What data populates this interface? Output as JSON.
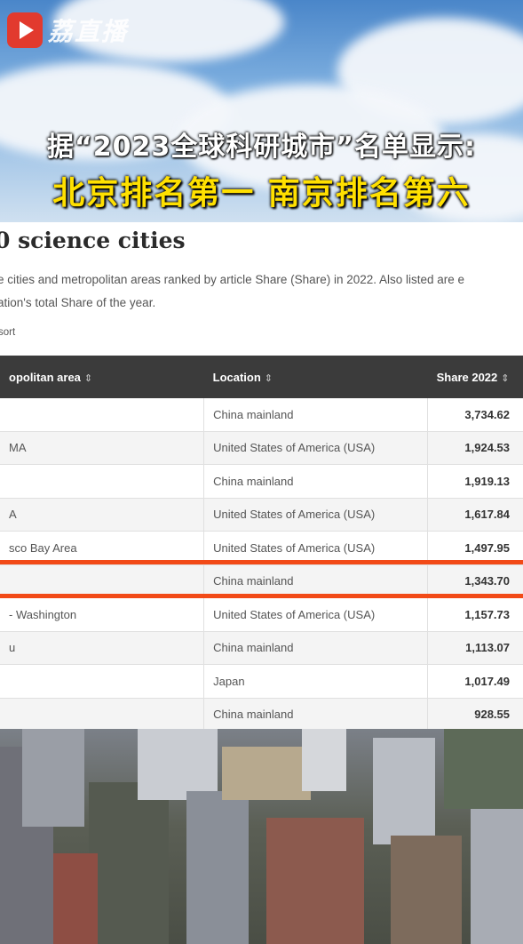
{
  "header": {
    "brand": "荔直播",
    "headline_line1": "据“2023全球科研城市”名单显示:",
    "headline_line2": "北京排名第一 南京排名第六"
  },
  "article": {
    "title": "0 science cities",
    "desc_line1": "e cities and metropolitan areas ranked by article Share (Share) in 2022. Also listed are e",
    "desc_line2": "ation's total Share of the year.",
    "sort_note": "sort"
  },
  "table": {
    "columns": [
      "opolitan area",
      "Location",
      "Share 2022"
    ],
    "sort_icon": "⇕",
    "rows": [
      {
        "area": "",
        "location": "China mainland",
        "share": "3,734.62"
      },
      {
        "area": "MA",
        "location": "United States of America (USA)",
        "share": "1,924.53"
      },
      {
        "area": "",
        "location": "China mainland",
        "share": "1,919.13"
      },
      {
        "area": "A",
        "location": "United States of America (USA)",
        "share": "1,617.84"
      },
      {
        "area": "sco Bay Area",
        "location": "United States of America (USA)",
        "share": "1,497.95"
      },
      {
        "area": "",
        "location": "China mainland",
        "share": "1,343.70"
      },
      {
        "area": "- Washington",
        "location": "United States of America (USA)",
        "share": "1,157.73"
      },
      {
        "area": "u",
        "location": "China mainland",
        "share": "1,113.07"
      },
      {
        "area": "",
        "location": "Japan",
        "share": "1,017.49"
      },
      {
        "area": "",
        "location": "China mainland",
        "share": "928.55"
      }
    ]
  },
  "colors": {
    "highlight_line": "#f24a17",
    "headline_yellow": "#ffe000",
    "header_bg": "#3b3b3b"
  }
}
